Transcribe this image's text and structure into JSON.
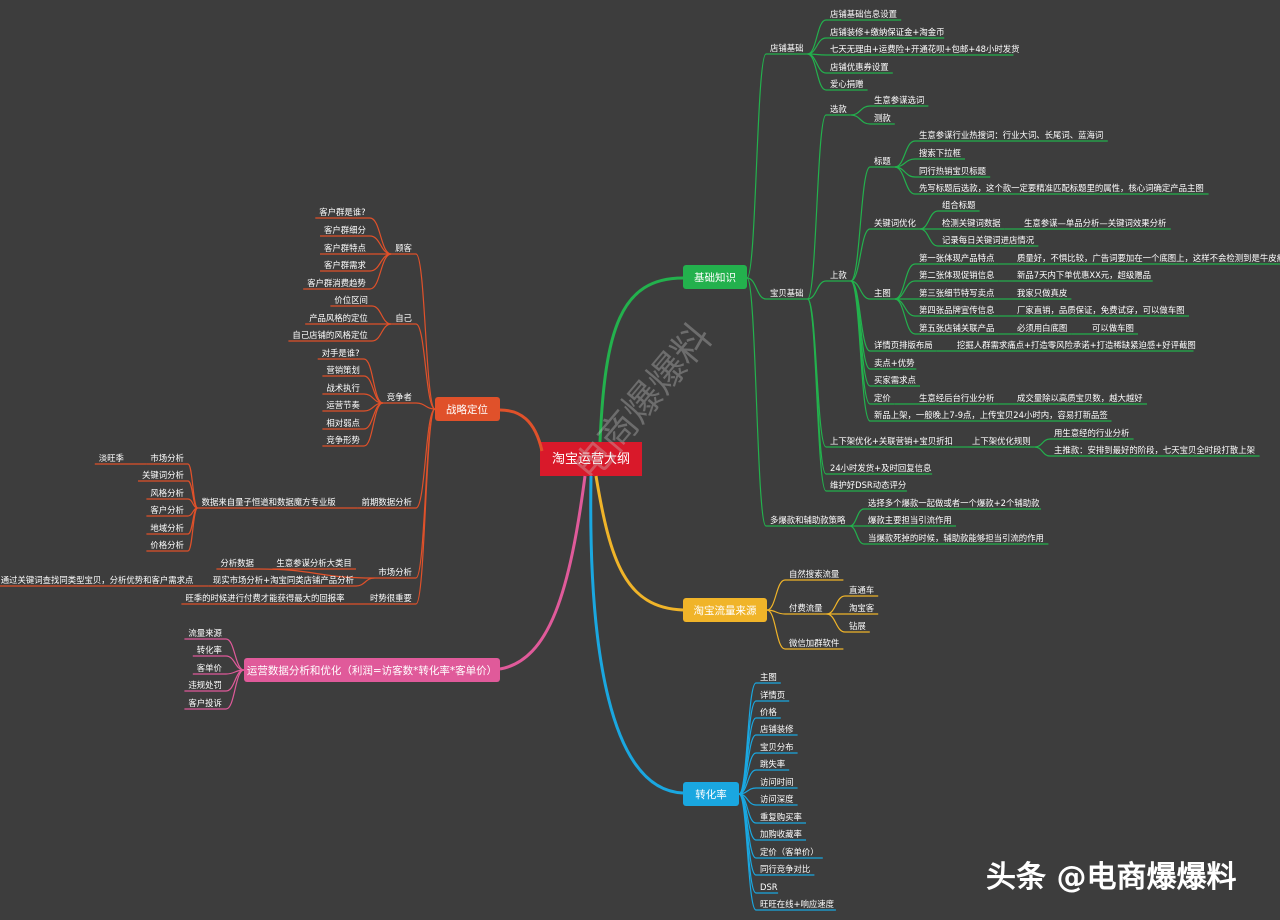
{
  "root": "淘宝运营大纲",
  "watermark": "电商爆爆料",
  "brand": "头条 @电商爆爆料",
  "colors": {
    "green": "#23b14d",
    "orange": "#f0b429",
    "blue": "#1aa7e0",
    "red": "#e0512a",
    "pink": "#e05a9a",
    "rootbox": "#d9192a"
  },
  "branches": {
    "basic": {
      "label": "基础知识",
      "store_basics": {
        "label": "店铺基础",
        "items": [
          "店铺基础信息设置",
          "店铺装修+缴纳保证金+淘金币",
          "七天无理由+运费险+开通花呗+包邮+48小时发货",
          "店铺优惠券设置",
          "爱心捐赠"
        ]
      },
      "product_basics": {
        "label": "宝贝基础",
        "selection": {
          "label": "选款",
          "items": [
            "生意参谋选词",
            "测款"
          ]
        },
        "listing": {
          "label": "上款",
          "title": {
            "label": "标题",
            "items": [
              "生意参谋行业热搜词：行业大词、长尾词、蓝海词",
              "搜索下拉框",
              "同行热销宝贝标题",
              "先写标题后选款，这个款一定要精准匹配标题里的属性，核心词确定产品主图"
            ]
          },
          "keyword": {
            "label": "关键词优化",
            "items": [
              "组合标题",
              "检测关键词数据",
              "记录每日关键词进店情况"
            ],
            "detect_child": "生意参谋—单品分析—关键词效果分析"
          },
          "main_image": {
            "label": "主图",
            "rows": [
              {
                "a": "第一张体现产品特点",
                "b": "质量好，不惧比较，广告词要加在一个底图上，这样不会检测到是牛皮癣"
              },
              {
                "a": "第二张体现促销信息",
                "b": "新品7天内下单优惠XX元，超级赠品"
              },
              {
                "a": "第三张细节特写卖点",
                "b": "我家只做真皮"
              },
              {
                "a": "第四张品牌宣传信息",
                "b": "厂家直销，品质保证，免费试穿，可以做车图"
              },
              {
                "a": "第五张店铺关联产品",
                "b": "必须用白底图",
                "c": "可以做车图"
              }
            ]
          },
          "detail": {
            "label": "详情页排版布局",
            "child": "挖掘人群需求痛点+打造零风险承诺+打造稀缺紧迫感+好评截图"
          },
          "selling_point": "卖点+优势",
          "buyer_demand": "买家需求点",
          "pricing": {
            "label": "定价",
            "a": "生意经后台行业分析",
            "b": "成交量除以高质宝贝数，越大越好"
          },
          "new_listing": "新品上架，一般晚上7-9点，上传宝贝24小时内，容易打新品签"
        },
        "shelf": {
          "label": "上下架优化+关联营销+宝贝折扣",
          "rule": "上下架优化规则",
          "items": [
            "用生意经的行业分析",
            "主推款：安排到最好的阶段，七天宝贝全时段打散上架"
          ]
        },
        "shipping": "24小时发货+及时回复信息",
        "dsr": "维护好DSR动态评分"
      },
      "hot": {
        "label": "多爆款和辅助款策略",
        "items": [
          "选择多个爆款一起做或者一个爆款+2个辅助款",
          "爆款主要担当引流作用",
          "当爆款死掉的时候，辅助款能够担当引流的作用"
        ]
      }
    },
    "traffic": {
      "label": "淘宝流量来源",
      "natural": "自然搜索流量",
      "paid": {
        "label": "付费流量",
        "items": [
          "直通车",
          "淘宝客",
          "钻展"
        ]
      },
      "wechat": "微信加群软件"
    },
    "conversion": {
      "label": "转化率",
      "items": [
        "主图",
        "详情页",
        "价格",
        "店铺装修",
        "宝贝分布",
        "跳失率",
        "访问时间",
        "访问深度",
        "重复购买率",
        "加购收藏率",
        "定价（客单价）",
        "同行竞争对比",
        "DSR",
        "旺旺在线+响应速度"
      ]
    },
    "strategy": {
      "label": "战略定位",
      "customer": {
        "label": "顾客",
        "items": [
          "客户群是谁?",
          "客户群细分",
          "客户群特点",
          "客户群需求",
          "客户群消费趋势"
        ]
      },
      "self": {
        "label": "自己",
        "items": [
          "价位区间",
          "产品风格的定位",
          "自己店铺的风格定位"
        ]
      },
      "competitor": {
        "label": "竞争者",
        "items": [
          "对手是谁?",
          "营销策划",
          "战术执行",
          "运营节奏",
          "相对弱点",
          "竞争形势"
        ]
      },
      "early": {
        "label": "前期数据分析",
        "source": "数据来自量子恒道和数据魔方专业版",
        "items": [
          "市场分析",
          "关键词分析",
          "风格分析",
          "客户分析",
          "地域分析",
          "价格分析"
        ],
        "market_child": "淡旺季"
      },
      "market": {
        "label": "市场分析",
        "analysis": {
          "label": "分析数据",
          "child": "生意参谋分析大类目"
        },
        "reality": {
          "label": "现实市场分析+淘宝同类店铺产品分析",
          "child": "通过关键词查找同类型宝贝，分析优势和客户需求点"
        }
      },
      "timing": {
        "label": "时势很重要",
        "child": "旺季的时候进行付费才能获得最大的回报率"
      }
    },
    "ops": {
      "label": "运营数据分析和优化（利润=访客数*转化率*客单价）",
      "items": [
        "流量来源",
        "转化率",
        "客单价",
        "违规处罚",
        "客户投诉"
      ]
    }
  }
}
